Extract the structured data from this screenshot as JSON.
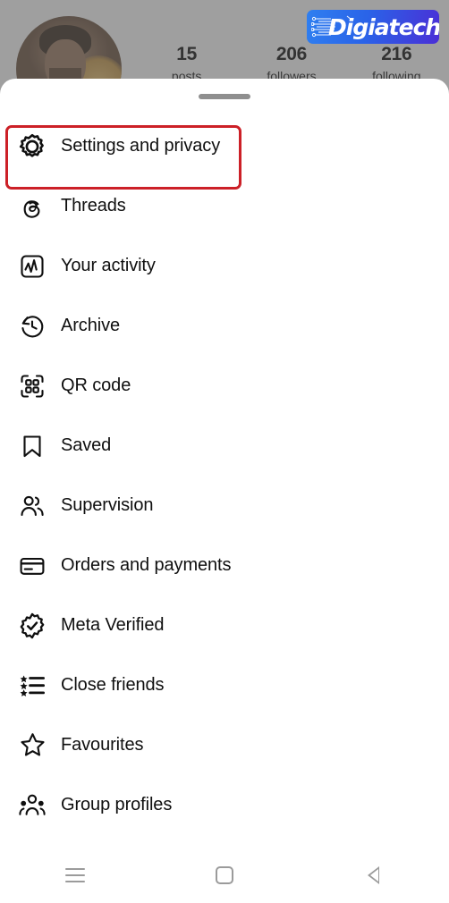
{
  "app": "Instagram profile menu",
  "profile": {
    "avatar_alt": "user-profile-photo",
    "stats": [
      {
        "value": "15",
        "label": "posts"
      },
      {
        "value": "206",
        "label": "followers"
      },
      {
        "value": "216",
        "label": "following"
      }
    ]
  },
  "sheet": {
    "handle": "drag-handle",
    "items": [
      {
        "label": "Settings and privacy",
        "icon": "gear-icon",
        "highlighted": true
      },
      {
        "label": "Threads",
        "icon": "threads-icon",
        "highlighted": false
      },
      {
        "label": "Your activity",
        "icon": "activity-chart-icon",
        "highlighted": false
      },
      {
        "label": "Archive",
        "icon": "archive-clock-icon",
        "highlighted": false
      },
      {
        "label": "QR code",
        "icon": "qr-code-icon",
        "highlighted": false
      },
      {
        "label": "Saved",
        "icon": "bookmark-icon",
        "highlighted": false
      },
      {
        "label": "Supervision",
        "icon": "two-people-icon",
        "highlighted": false
      },
      {
        "label": "Orders and payments",
        "icon": "credit-card-icon",
        "highlighted": false
      },
      {
        "label": "Meta Verified",
        "icon": "verified-badge-icon",
        "highlighted": false
      },
      {
        "label": "Close friends",
        "icon": "star-list-icon",
        "highlighted": false
      },
      {
        "label": "Favourites",
        "icon": "star-icon",
        "highlighted": false
      },
      {
        "label": "Group profiles",
        "icon": "three-people-icon",
        "highlighted": false
      }
    ]
  },
  "navbar": {
    "recents": "recents-icon",
    "home": "home-icon",
    "back": "back-icon"
  },
  "watermark": {
    "text": "Digiatech",
    "bg_start": "#2f7ff0",
    "bg_end": "#4a2fd6"
  },
  "colors": {
    "highlight": "#cc2027",
    "sheet_bg": "#ffffff",
    "scrim": "rgba(80,80,80,0.55)",
    "text": "#0f0f0f",
    "nav_icon": "#9b9b9b"
  }
}
